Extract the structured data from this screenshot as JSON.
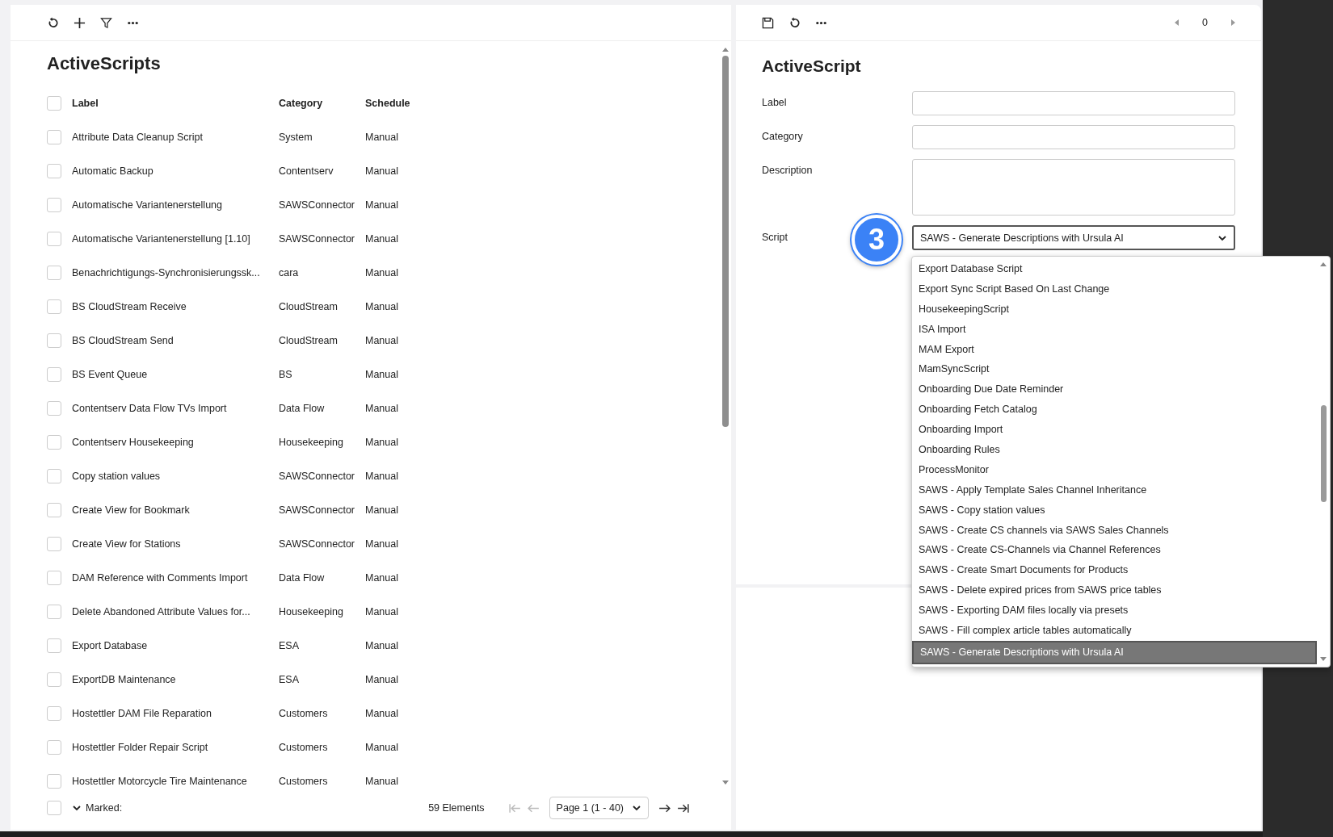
{
  "list_panel": {
    "title": "ActiveScripts",
    "columns": [
      {
        "label": "Label"
      },
      {
        "label": "Category"
      },
      {
        "label": "Schedule"
      }
    ],
    "header_checked": false,
    "rows": [
      {
        "label": "Attribute Data Cleanup Script",
        "category": "System",
        "schedule": "Manual",
        "checked": false
      },
      {
        "label": "Automatic Backup",
        "category": "Contentserv",
        "schedule": "Manual",
        "checked": false
      },
      {
        "label": "Automatische Variantenerstellung",
        "category": "SAWSConnector",
        "schedule": "Manual",
        "checked": false
      },
      {
        "label": "Automatische Variantenerstellung [1.10]",
        "category": "SAWSConnector",
        "schedule": "Manual",
        "checked": false
      },
      {
        "label": "Benachrichtigungs-Synchronisierungssk...",
        "category": "cara",
        "schedule": "Manual",
        "checked": false
      },
      {
        "label": "BS CloudStream Receive",
        "category": "CloudStream",
        "schedule": "Manual",
        "checked": false
      },
      {
        "label": "BS CloudStream Send",
        "category": "CloudStream",
        "schedule": "Manual",
        "checked": false
      },
      {
        "label": "BS Event Queue",
        "category": "BS",
        "schedule": "Manual",
        "checked": false
      },
      {
        "label": "Contentserv Data Flow TVs Import",
        "category": "Data Flow",
        "schedule": "Manual",
        "checked": false
      },
      {
        "label": "Contentserv Housekeeping",
        "category": "Housekeeping",
        "schedule": "Manual",
        "checked": false
      },
      {
        "label": "Copy station values",
        "category": "SAWSConnector",
        "schedule": "Manual",
        "checked": false
      },
      {
        "label": "Create View for Bookmark",
        "category": "SAWSConnector",
        "schedule": "Manual",
        "checked": false
      },
      {
        "label": "Create View for Stations",
        "category": "SAWSConnector",
        "schedule": "Manual",
        "checked": false
      },
      {
        "label": "DAM Reference with Comments Import",
        "category": "Data Flow",
        "schedule": "Manual",
        "checked": false
      },
      {
        "label": "Delete Abandoned Attribute Values for...",
        "category": "Housekeeping",
        "schedule": "Manual",
        "checked": false
      },
      {
        "label": "Export Database",
        "category": "ESA",
        "schedule": "Manual",
        "checked": false
      },
      {
        "label": "ExportDB Maintenance",
        "category": "ESA",
        "schedule": "Manual",
        "checked": false
      },
      {
        "label": "Hostettler DAM File Reparation",
        "category": "Customers",
        "schedule": "Manual",
        "checked": false
      },
      {
        "label": "Hostettler Folder Repair Script",
        "category": "Customers",
        "schedule": "Manual",
        "checked": false
      },
      {
        "label": "Hostettler Motorcycle Tire Maintenance",
        "category": "Customers",
        "schedule": "Manual",
        "checked": false
      }
    ],
    "footer": {
      "checked": false,
      "marked": "Marked:",
      "count": "59 Elements",
      "page": "Page 1 (1 - 40)",
      "first_disabled": true,
      "prev_disabled": true,
      "next_disabled": false,
      "last_disabled": false
    }
  },
  "detail_panel": {
    "counter": "0",
    "title": "ActiveScript",
    "fields": [
      {
        "label": "Label",
        "kind": "text"
      },
      {
        "label": "Category",
        "kind": "text"
      },
      {
        "label": "Description",
        "kind": "textarea"
      },
      {
        "label": "Script",
        "kind": "select",
        "value": "SAWS - Generate Descriptions with Ursula AI"
      }
    ],
    "step_badge": "3",
    "dropdown": [
      {
        "label": "Export Database Script",
        "selected": false
      },
      {
        "label": "Export Sync Script Based On Last Change",
        "selected": false
      },
      {
        "label": "HousekeepingScript",
        "selected": false
      },
      {
        "label": "ISA Import",
        "selected": false
      },
      {
        "label": "MAM Export",
        "selected": false
      },
      {
        "label": "MamSyncScript",
        "selected": false
      },
      {
        "label": "Onboarding Due Date Reminder",
        "selected": false
      },
      {
        "label": "Onboarding Fetch Catalog",
        "selected": false
      },
      {
        "label": "Onboarding Import",
        "selected": false
      },
      {
        "label": "Onboarding Rules",
        "selected": false
      },
      {
        "label": "ProcessMonitor",
        "selected": false
      },
      {
        "label": "SAWS - Apply Template Sales Channel Inheritance",
        "selected": false
      },
      {
        "label": "SAWS - Copy station values",
        "selected": false
      },
      {
        "label": "SAWS - Create CS channels via SAWS Sales Channels",
        "selected": false
      },
      {
        "label": "SAWS - Create CS-Channels via Channel References",
        "selected": false
      },
      {
        "label": "SAWS - Create Smart Documents for Products",
        "selected": false
      },
      {
        "label": "SAWS - Delete expired prices from SAWS price tables",
        "selected": false
      },
      {
        "label": "SAWS - Exporting DAM files locally via presets",
        "selected": false
      },
      {
        "label": "SAWS - Fill complex article tables automatically",
        "selected": false
      },
      {
        "label": "SAWS - Generate Descriptions with Ursula AI",
        "selected": true
      }
    ]
  }
}
